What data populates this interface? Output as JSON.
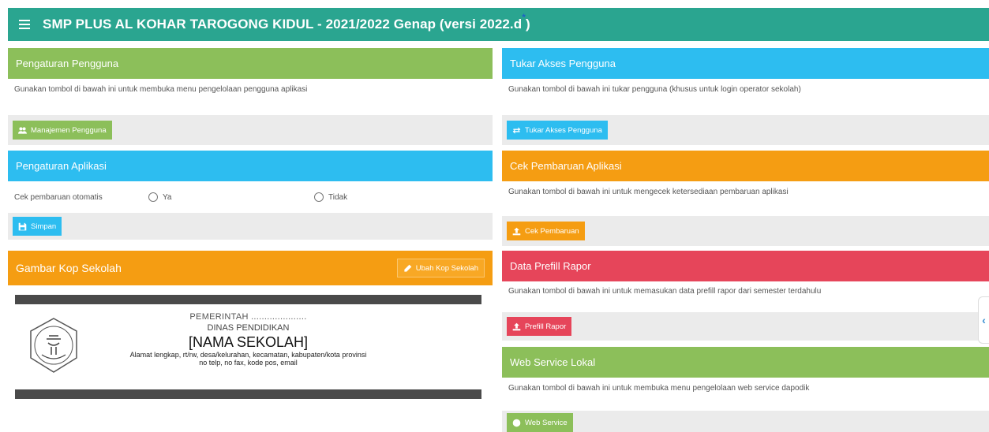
{
  "header": {
    "title": "SMP PLUS AL KOHAR TAROGONG KIDUL - 2021/2022 Genap (versi 2022.d",
    "title_sup": "*",
    "title_end": ")"
  },
  "panels": {
    "pengguna": {
      "title": "Pengaturan Pengguna",
      "desc": "Gunakan tombol di bawah ini untuk membuka menu pengelolaan pengguna aplikasi",
      "button": "Manajemen Pengguna"
    },
    "tukar": {
      "title": "Tukar Akses Pengguna",
      "desc": "Gunakan tombol di bawah ini tukar pengguna (khusus untuk login operator sekolah)",
      "button": "Tukar Akses Pengguna"
    },
    "aplikasi": {
      "title": "Pengaturan Aplikasi",
      "label": "Cek pembaruan otomatis",
      "opt_yes": "Ya",
      "opt_no": "Tidak",
      "button": "Simpan"
    },
    "cek": {
      "title": "Cek Pembaruan Aplikasi",
      "desc": "Gunakan tombol di bawah ini untuk mengecek ketersediaan pembaruan aplikasi",
      "button": "Cek Pembaruan"
    },
    "kop": {
      "title": "Gambar Kop Sekolah",
      "button": "Ubah Kop Sekolah",
      "line1": "PEMERINTAH .....................",
      "line2": "DINAS PENDIDIKAN",
      "line3": "[NAMA SEKOLAH]",
      "line4": "Alamat lengkap, rt/rw, desa/kelurahan, kecamatan, kabupaten/kota provinsi",
      "line5": "no telp, no fax, kode pos, email"
    },
    "rapor": {
      "title": "Data Prefill Rapor",
      "desc": "Gunakan tombol di bawah ini untuk memasukan data prefill rapor dari semester terdahulu",
      "button": "Prefill Rapor"
    },
    "webservice": {
      "title": "Web Service Lokal",
      "desc": "Gunakan tombol di bawah ini untuk membuka menu pengelolaan web service dapodik",
      "button": "Web Service"
    }
  },
  "side_tab": "‹",
  "colors": {
    "teal": "#2aa590",
    "green": "#8cbf5a",
    "blue": "#2dbdf0",
    "orange": "#f59d12",
    "red": "#e6455a"
  }
}
